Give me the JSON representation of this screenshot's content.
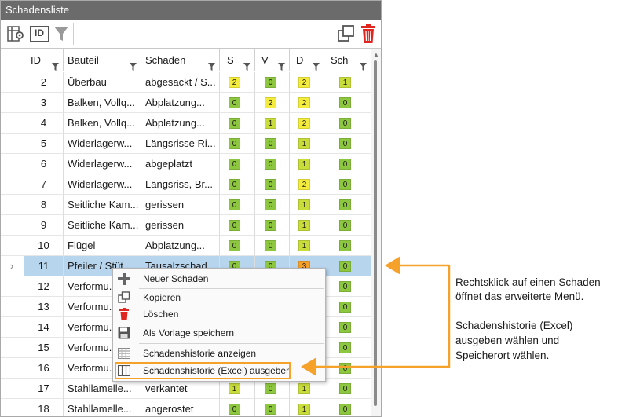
{
  "window": {
    "title": "Schadensliste"
  },
  "toolbar": {
    "settings_icon": "column-settings-icon",
    "id_label": "ID",
    "filter_icon": "filter-icon",
    "copy_icon": "copy-icon",
    "delete_icon": "trash-icon"
  },
  "columns": [
    {
      "key": "id",
      "label": "ID"
    },
    {
      "key": "bauteil",
      "label": "Bauteil"
    },
    {
      "key": "schaden",
      "label": "Schaden"
    },
    {
      "key": "s",
      "label": "S"
    },
    {
      "key": "v",
      "label": "V"
    },
    {
      "key": "d",
      "label": "D"
    },
    {
      "key": "sch",
      "label": "Sch"
    }
  ],
  "rows": [
    {
      "id": "2",
      "bauteil": "Überbau",
      "schaden": "abgesackt / S...",
      "s": "2",
      "v": "0",
      "d": "2",
      "sch": "1"
    },
    {
      "id": "3",
      "bauteil": "Balken, Vollq...",
      "schaden": "Abplatzung...",
      "s": "0",
      "v": "2",
      "d": "2",
      "sch": "0"
    },
    {
      "id": "4",
      "bauteil": "Balken, Vollq...",
      "schaden": "Abplatzung...",
      "s": "0",
      "v": "1",
      "d": "2",
      "sch": "0"
    },
    {
      "id": "5",
      "bauteil": "Widerlagerw...",
      "schaden": "Längsrisse Ri...",
      "s": "0",
      "v": "0",
      "d": "1",
      "sch": "0"
    },
    {
      "id": "6",
      "bauteil": "Widerlagerw...",
      "schaden": "abgeplatzt",
      "s": "0",
      "v": "0",
      "d": "1",
      "sch": "0"
    },
    {
      "id": "7",
      "bauteil": "Widerlagerw...",
      "schaden": "Längsriss, Br...",
      "s": "0",
      "v": "0",
      "d": "2",
      "sch": "0"
    },
    {
      "id": "8",
      "bauteil": "Seitliche Kam...",
      "schaden": "gerissen",
      "s": "0",
      "v": "0",
      "d": "1",
      "sch": "0"
    },
    {
      "id": "9",
      "bauteil": "Seitliche Kam...",
      "schaden": "gerissen",
      "s": "0",
      "v": "0",
      "d": "1",
      "sch": "0"
    },
    {
      "id": "10",
      "bauteil": "Flügel",
      "schaden": "Abplatzung...",
      "s": "0",
      "v": "0",
      "d": "1",
      "sch": "0"
    },
    {
      "id": "11",
      "bauteil": "Pfeiler / Stüt...",
      "schaden": "Tausalzschad...",
      "s": "0",
      "v": "0",
      "d": "3",
      "sch": "0"
    },
    {
      "id": "12",
      "bauteil": "Verformu...",
      "schaden": "",
      "s": "",
      "v": "",
      "d": "",
      "sch": "0"
    },
    {
      "id": "13",
      "bauteil": "Verformu...",
      "schaden": "",
      "s": "",
      "v": "",
      "d": "",
      "sch": "0"
    },
    {
      "id": "14",
      "bauteil": "Verformu...",
      "schaden": "",
      "s": "",
      "v": "",
      "d": "",
      "sch": "0"
    },
    {
      "id": "15",
      "bauteil": "Verformu...",
      "schaden": "",
      "s": "",
      "v": "",
      "d": "",
      "sch": "0"
    },
    {
      "id": "16",
      "bauteil": "Verformu...",
      "schaden": "",
      "s": "",
      "v": "",
      "d": "",
      "sch": "0"
    },
    {
      "id": "17",
      "bauteil": "Stahllamelle...",
      "schaden": "verkantet",
      "s": "1",
      "v": "0",
      "d": "1",
      "sch": "0"
    },
    {
      "id": "18",
      "bauteil": "Stahllamelle...",
      "schaden": "angerostet",
      "s": "0",
      "v": "0",
      "d": "1",
      "sch": "0"
    }
  ],
  "selected_row_index": 9,
  "selected_row_marker": "›",
  "context_menu": {
    "items": [
      {
        "label": "Neuer Schaden",
        "icon": "plus-icon"
      },
      {
        "label": "Kopieren",
        "icon": "copy-icon"
      },
      {
        "label": "Löschen",
        "icon": "trash-icon"
      },
      {
        "label": "Als Vorlage speichern",
        "icon": "save-icon"
      },
      {
        "label": "Schadenshistorie anzeigen",
        "icon": "table-icon"
      },
      {
        "label": "Schadenshistorie (Excel) ausgeben",
        "icon": "columns-icon"
      }
    ],
    "highlighted_index": 5
  },
  "annotation": {
    "line1": "Rechtsklick auf einen Schaden",
    "line2": "öffnet das erweiterte Menü.",
    "line3": "Schadenshistorie (Excel)",
    "line4": "ausgeben wählen und",
    "line5": "Speicherort wählen."
  },
  "colors": {
    "level_0": "#8dc63f",
    "level_1": "#c8dc3a",
    "level_2": "#f4ec3c",
    "level_3": "#f5a12a",
    "accent_orange": "#f5a12a",
    "title_bar": "#6b6b6b",
    "selected_row": "#b8d5ee",
    "trash_red": "#e0261e"
  }
}
